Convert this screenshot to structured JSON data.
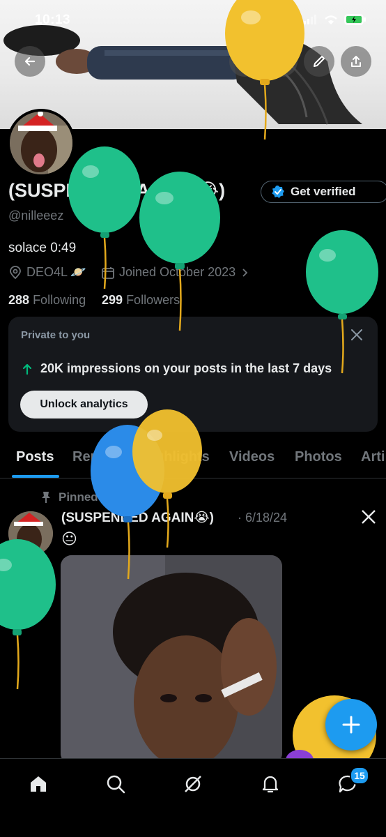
{
  "status_bar": {
    "time": "10:13"
  },
  "profile": {
    "name": "(SUSPENDED AGAIN😭)",
    "verify_label": "Get verified",
    "handle": "@nilleeez",
    "bio": "solace 0:49",
    "location": "DEO4L 🪐",
    "joined": "Joined October 2023",
    "following_count": "288",
    "following_label": "Following",
    "followers_count": "299",
    "followers_label": "Followers"
  },
  "analytics_card": {
    "label": "Private to you",
    "stat": "20K impressions on your posts in the last 7 days",
    "button_label": "Unlock analytics"
  },
  "tabs": [
    {
      "label": "Posts",
      "active": true
    },
    {
      "label": "Replies"
    },
    {
      "label": "Highlights"
    },
    {
      "label": "Videos"
    },
    {
      "label": "Photos"
    },
    {
      "label": "Arti"
    }
  ],
  "pinned_post": {
    "pinned_label": "Pinned",
    "author": "(SUSPENDED AGAIN😭)",
    "date": "· 6/18/24",
    "text": "😐"
  },
  "bottom_nav": {
    "messages_badge": "15",
    "items": [
      "home-icon",
      "search-icon",
      "grok-icon",
      "notifications-icon",
      "messages-icon"
    ]
  },
  "colors": {
    "accent": "#1d9bf0",
    "balloon_green": "#1fc08a",
    "balloon_yellow": "#f2c12e",
    "balloon_blue": "#2b8be8"
  }
}
